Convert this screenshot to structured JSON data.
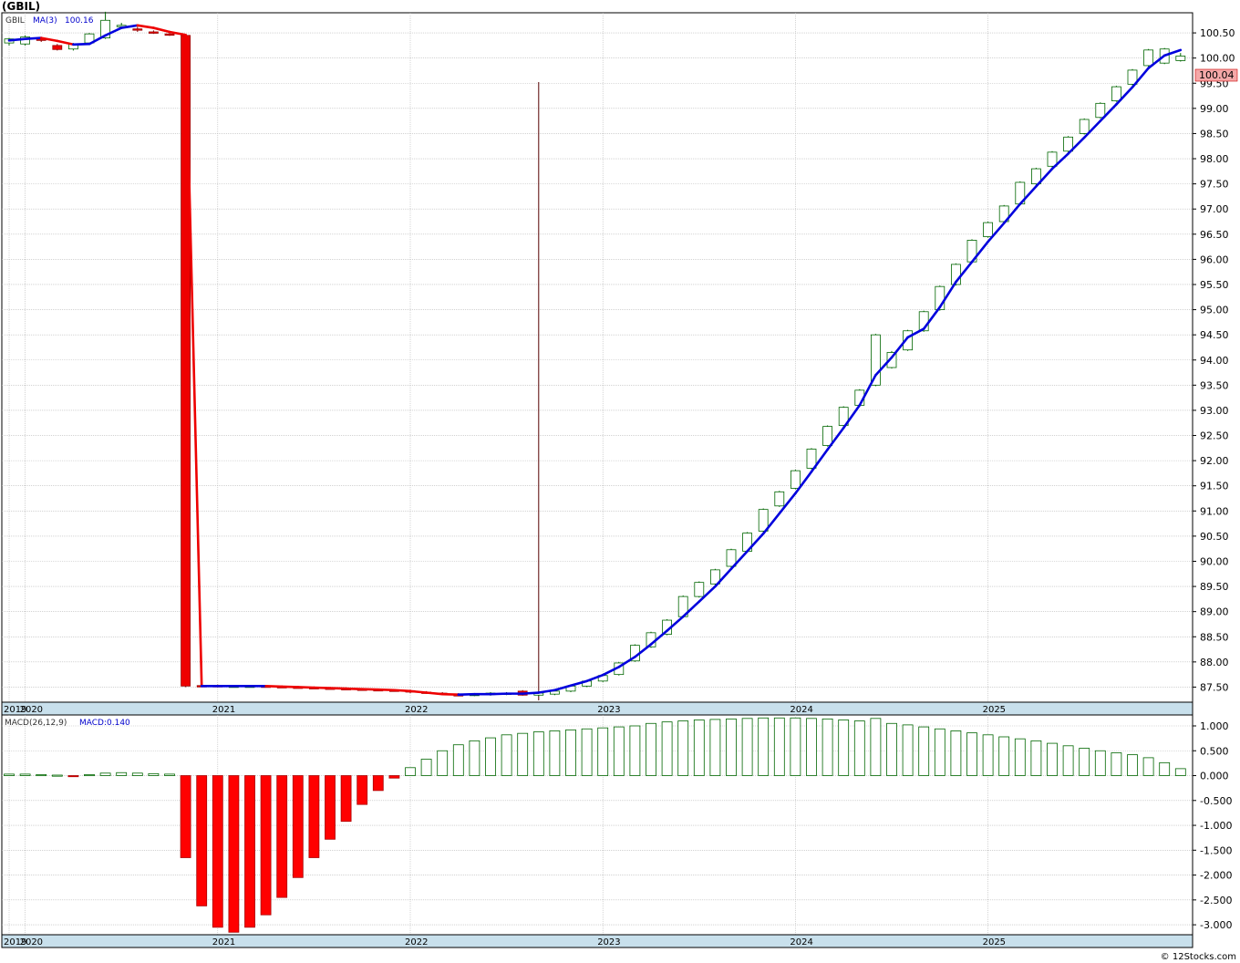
{
  "page": {
    "title": "(GBIL)",
    "credit": "© 12Stocks.com"
  },
  "chart_data": [
    {
      "type": "candlestick",
      "symbol": "GBIL",
      "legend": {
        "symbol": "GBIL",
        "ma_label": "MA(3)",
        "ma_value": "100.16"
      },
      "last_price_label": "100.04",
      "ylim": [
        87.2,
        100.9
      ],
      "y_ticks": [
        87.5,
        88.0,
        88.5,
        89.0,
        89.5,
        90.0,
        90.5,
        91.0,
        91.5,
        92.0,
        92.5,
        93.0,
        93.5,
        94.0,
        94.5,
        95.0,
        95.5,
        96.0,
        96.5,
        97.0,
        97.5,
        98.0,
        98.5,
        99.0,
        99.5,
        100.0,
        100.5
      ],
      "x_labels": [
        "2019",
        "2020",
        "2021",
        "2022",
        "2023",
        "2024",
        "2025"
      ],
      "x_label_months": [
        0,
        1,
        13,
        25,
        37,
        49,
        61
      ],
      "cursor_month": 33,
      "candles": [
        {
          "m": 0,
          "o": 100.3,
          "h": 100.4,
          "l": 100.25,
          "c": 100.38
        },
        {
          "m": 1,
          "o": 100.28,
          "h": 100.45,
          "l": 100.25,
          "c": 100.42
        },
        {
          "m": 2,
          "o": 100.38,
          "h": 100.42,
          "l": 100.32,
          "c": 100.35
        },
        {
          "m": 3,
          "o": 100.25,
          "h": 100.28,
          "l": 100.15,
          "c": 100.17
        },
        {
          "m": 4,
          "o": 100.18,
          "h": 100.3,
          "l": 100.15,
          "c": 100.28
        },
        {
          "m": 5,
          "o": 100.3,
          "h": 100.5,
          "l": 100.28,
          "c": 100.48
        },
        {
          "m": 6,
          "o": 100.4,
          "h": 100.92,
          "l": 100.38,
          "c": 100.75
        },
        {
          "m": 7,
          "o": 100.65,
          "h": 100.7,
          "l": 100.6,
          "c": 100.65
        },
        {
          "m": 8,
          "o": 100.58,
          "h": 100.62,
          "l": 100.52,
          "c": 100.56
        },
        {
          "m": 9,
          "o": 100.52,
          "h": 100.55,
          "l": 100.48,
          "c": 100.5
        },
        {
          "m": 10,
          "o": 100.48,
          "h": 100.52,
          "l": 100.44,
          "c": 100.46
        },
        {
          "m": 11,
          "o": 100.45,
          "h": 100.48,
          "l": 87.5,
          "c": 87.52
        },
        {
          "m": 12,
          "o": 87.53,
          "h": 87.55,
          "l": 87.5,
          "c": 87.52
        },
        {
          "m": 13,
          "o": 87.53,
          "h": 87.55,
          "l": 87.51,
          "c": 87.52
        },
        {
          "m": 14,
          "o": 87.52,
          "h": 87.54,
          "l": 87.5,
          "c": 87.52
        },
        {
          "m": 15,
          "o": 87.51,
          "h": 87.53,
          "l": 87.5,
          "c": 87.52
        },
        {
          "m": 16,
          "o": 87.52,
          "h": 87.54,
          "l": 87.5,
          "c": 87.51
        },
        {
          "m": 17,
          "o": 87.51,
          "h": 87.53,
          "l": 87.49,
          "c": 87.5
        },
        {
          "m": 18,
          "o": 87.5,
          "h": 87.52,
          "l": 87.48,
          "c": 87.49
        },
        {
          "m": 19,
          "o": 87.49,
          "h": 87.51,
          "l": 87.47,
          "c": 87.48
        },
        {
          "m": 20,
          "o": 87.48,
          "h": 87.5,
          "l": 87.46,
          "c": 87.47
        },
        {
          "m": 21,
          "o": 87.47,
          "h": 87.49,
          "l": 87.45,
          "c": 87.46
        },
        {
          "m": 22,
          "o": 87.46,
          "h": 87.48,
          "l": 87.44,
          "c": 87.45
        },
        {
          "m": 23,
          "o": 87.45,
          "h": 87.47,
          "l": 87.43,
          "c": 87.44
        },
        {
          "m": 24,
          "o": 87.44,
          "h": 87.46,
          "l": 87.42,
          "c": 87.43
        },
        {
          "m": 25,
          "o": 87.43,
          "h": 87.45,
          "l": 87.38,
          "c": 87.4
        },
        {
          "m": 26,
          "o": 87.4,
          "h": 87.42,
          "l": 87.37,
          "c": 87.38
        },
        {
          "m": 27,
          "o": 87.38,
          "h": 87.4,
          "l": 87.35,
          "c": 87.36
        },
        {
          "m": 28,
          "o": 87.35,
          "h": 87.38,
          "l": 87.33,
          "c": 87.34
        },
        {
          "m": 29,
          "o": 87.33,
          "h": 87.38,
          "l": 87.32,
          "c": 87.36
        },
        {
          "m": 30,
          "o": 87.35,
          "h": 87.4,
          "l": 87.33,
          "c": 87.38
        },
        {
          "m": 31,
          "o": 87.37,
          "h": 87.4,
          "l": 87.34,
          "c": 87.38
        },
        {
          "m": 32,
          "o": 87.42,
          "h": 87.44,
          "l": 87.33,
          "c": 87.34
        },
        {
          "m": 33,
          "o": 87.34,
          "h": 87.4,
          "l": 87.32,
          "c": 87.38
        },
        {
          "m": 34,
          "o": 87.36,
          "h": 87.44,
          "l": 87.34,
          "c": 87.42
        },
        {
          "m": 35,
          "o": 87.42,
          "h": 87.54,
          "l": 87.4,
          "c": 87.52
        },
        {
          "m": 36,
          "o": 87.52,
          "h": 87.64,
          "l": 87.5,
          "c": 87.62
        },
        {
          "m": 37,
          "o": 87.62,
          "h": 87.75,
          "l": 87.6,
          "c": 87.73
        },
        {
          "m": 38,
          "o": 87.75,
          "h": 88.0,
          "l": 87.73,
          "c": 87.98
        },
        {
          "m": 39,
          "o": 88.02,
          "h": 88.35,
          "l": 88.0,
          "c": 88.33
        },
        {
          "m": 40,
          "o": 88.3,
          "h": 88.6,
          "l": 88.28,
          "c": 88.58
        },
        {
          "m": 41,
          "o": 88.55,
          "h": 88.85,
          "l": 88.53,
          "c": 88.83
        },
        {
          "m": 42,
          "o": 88.9,
          "h": 89.32,
          "l": 88.88,
          "c": 89.3
        },
        {
          "m": 43,
          "o": 89.3,
          "h": 89.6,
          "l": 89.28,
          "c": 89.58
        },
        {
          "m": 44,
          "o": 89.55,
          "h": 89.85,
          "l": 89.53,
          "c": 89.83
        },
        {
          "m": 45,
          "o": 89.9,
          "h": 90.25,
          "l": 89.88,
          "c": 90.23
        },
        {
          "m": 46,
          "o": 90.2,
          "h": 90.58,
          "l": 90.18,
          "c": 90.56
        },
        {
          "m": 47,
          "o": 90.6,
          "h": 91.05,
          "l": 90.58,
          "c": 91.03
        },
        {
          "m": 48,
          "o": 91.1,
          "h": 91.4,
          "l": 91.08,
          "c": 91.38
        },
        {
          "m": 49,
          "o": 91.45,
          "h": 91.82,
          "l": 91.43,
          "c": 91.8
        },
        {
          "m": 50,
          "o": 91.85,
          "h": 92.25,
          "l": 91.83,
          "c": 92.23
        },
        {
          "m": 51,
          "o": 92.3,
          "h": 92.7,
          "l": 92.28,
          "c": 92.68
        },
        {
          "m": 52,
          "o": 92.7,
          "h": 93.08,
          "l": 92.68,
          "c": 93.06
        },
        {
          "m": 53,
          "o": 93.1,
          "h": 93.42,
          "l": 93.08,
          "c": 93.4
        },
        {
          "m": 54,
          "o": 93.5,
          "h": 94.52,
          "l": 93.48,
          "c": 94.5
        },
        {
          "m": 55,
          "o": 93.85,
          "h": 94.18,
          "l": 93.83,
          "c": 94.15
        },
        {
          "m": 56,
          "o": 94.2,
          "h": 94.6,
          "l": 94.18,
          "c": 94.58
        },
        {
          "m": 57,
          "o": 94.58,
          "h": 94.98,
          "l": 94.56,
          "c": 94.96
        },
        {
          "m": 58,
          "o": 95.0,
          "h": 95.48,
          "l": 94.98,
          "c": 95.46
        },
        {
          "m": 59,
          "o": 95.5,
          "h": 95.92,
          "l": 95.48,
          "c": 95.9
        },
        {
          "m": 60,
          "o": 95.95,
          "h": 96.4,
          "l": 95.93,
          "c": 96.38
        },
        {
          "m": 61,
          "o": 96.45,
          "h": 96.75,
          "l": 96.43,
          "c": 96.73
        },
        {
          "m": 62,
          "o": 96.75,
          "h": 97.08,
          "l": 96.73,
          "c": 97.06
        },
        {
          "m": 63,
          "o": 97.1,
          "h": 97.55,
          "l": 97.08,
          "c": 97.53
        },
        {
          "m": 64,
          "o": 97.5,
          "h": 97.82,
          "l": 97.48,
          "c": 97.8
        },
        {
          "m": 65,
          "o": 97.85,
          "h": 98.15,
          "l": 97.83,
          "c": 98.13
        },
        {
          "m": 66,
          "o": 98.15,
          "h": 98.45,
          "l": 98.13,
          "c": 98.43
        },
        {
          "m": 67,
          "o": 98.5,
          "h": 98.8,
          "l": 98.48,
          "c": 98.78
        },
        {
          "m": 68,
          "o": 98.82,
          "h": 99.12,
          "l": 98.8,
          "c": 99.1
        },
        {
          "m": 69,
          "o": 99.15,
          "h": 99.45,
          "l": 99.13,
          "c": 99.43
        },
        {
          "m": 70,
          "o": 99.48,
          "h": 99.78,
          "l": 99.46,
          "c": 99.76
        },
        {
          "m": 71,
          "o": 99.85,
          "h": 100.18,
          "l": 99.83,
          "c": 100.16
        },
        {
          "m": 72,
          "o": 99.9,
          "h": 100.2,
          "l": 99.88,
          "c": 100.18
        },
        {
          "m": 73,
          "o": 99.95,
          "h": 100.1,
          "l": 99.93,
          "c": 100.04
        }
      ],
      "ma": [
        100.35,
        100.38,
        100.4,
        100.34,
        100.27,
        100.28,
        100.45,
        100.6,
        100.65,
        100.6,
        100.52,
        100.46,
        87.52,
        87.52,
        87.52,
        87.52,
        87.52,
        87.51,
        87.5,
        87.49,
        87.48,
        87.47,
        87.46,
        87.45,
        87.44,
        87.42,
        87.39,
        87.36,
        87.35,
        87.36,
        87.36,
        87.37,
        87.37,
        87.39,
        87.44,
        87.53,
        87.62,
        87.74,
        87.9,
        88.1,
        88.35,
        88.62,
        88.9,
        89.2,
        89.5,
        89.85,
        90.2,
        90.55,
        90.95,
        91.35,
        91.78,
        92.22,
        92.65,
        93.1,
        93.7,
        94.05,
        94.45,
        94.62,
        95.05,
        95.55,
        95.95,
        96.35,
        96.72,
        97.1,
        97.45,
        97.8,
        98.1,
        98.42,
        98.75,
        99.08,
        99.42,
        99.8,
        100.05,
        100.16
      ],
      "ma_color_rules": {
        "up": "#0000dd",
        "down": "#ee0000"
      }
    },
    {
      "type": "bar",
      "indicator": "MACD",
      "legend": {
        "label": "MACD(26,12,9)",
        "value_label": "MACD:0.140"
      },
      "ylim": [
        -3.2,
        1.22
      ],
      "y_ticks": [
        1.0,
        0.5,
        0.0,
        -0.5,
        -1.0,
        -1.5,
        -2.0,
        -2.5,
        -3.0
      ],
      "y_tick_labels": [
        "1.000",
        "0.500",
        "0.000",
        "-0.500",
        "-1.000",
        "-1.500",
        "-2.000",
        "-2.500",
        "-3.000"
      ],
      "x_labels": [
        "2019",
        "2020",
        "2021",
        "2022",
        "2023",
        "2024",
        "2025"
      ],
      "values": [
        0.03,
        0.03,
        0.02,
        0.01,
        -0.01,
        0.02,
        0.05,
        0.06,
        0.05,
        0.04,
        0.03,
        -1.65,
        -2.62,
        -3.05,
        -3.15,
        -3.05,
        -2.8,
        -2.45,
        -2.05,
        -1.65,
        -1.28,
        -0.92,
        -0.58,
        -0.3,
        -0.05,
        0.16,
        0.33,
        0.5,
        0.62,
        0.7,
        0.76,
        0.82,
        0.85,
        0.88,
        0.9,
        0.92,
        0.94,
        0.96,
        0.98,
        1.0,
        1.05,
        1.08,
        1.1,
        1.12,
        1.13,
        1.14,
        1.15,
        1.16,
        1.16,
        1.16,
        1.15,
        1.14,
        1.12,
        1.1,
        1.15,
        1.05,
        1.02,
        0.98,
        0.94,
        0.9,
        0.86,
        0.82,
        0.78,
        0.74,
        0.7,
        0.65,
        0.6,
        0.55,
        0.5,
        0.46,
        0.42,
        0.36,
        0.26,
        0.14
      ]
    }
  ]
}
